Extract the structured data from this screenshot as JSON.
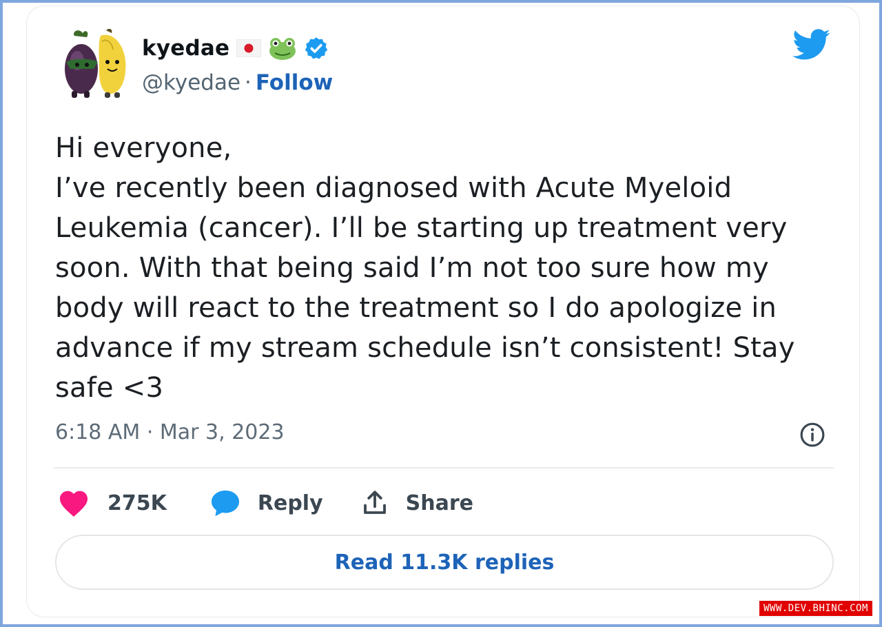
{
  "author": {
    "display_name": "kyedae",
    "handle": "@kyedae",
    "separator": "·",
    "follow_label": "Follow",
    "emoji_icons": [
      "japan-flag-icon",
      "frog-icon"
    ],
    "verified": true
  },
  "tweet": {
    "lines": [
      "Hi everyone,",
      "I’ve recently been diagnosed with Acute Myeloid",
      "Leukemia (cancer). I’ll be starting up treatment very",
      "soon. With that being said I’m not too sure how my",
      "body will react to the treatment so I do apologize in",
      "advance if my stream schedule isn’t consistent! Stay",
      "safe <3"
    ],
    "timestamp": "6:18 AM · Mar 3, 2023"
  },
  "actions": {
    "likes_count": "275K",
    "reply_label": "Reply",
    "share_label": "Share"
  },
  "read_replies_label": "Read 11.3K replies",
  "watermark": "WWW.DEV.BHINC.COM",
  "colors": {
    "frame_border": "#7fa6de",
    "twitter_blue": "#1d9bf0",
    "link_blue": "#1d63b8",
    "heart_pink": "#f91880",
    "text": "#1b1f23",
    "muted": "#5d6b78",
    "watermark_bg": "#e10000"
  }
}
